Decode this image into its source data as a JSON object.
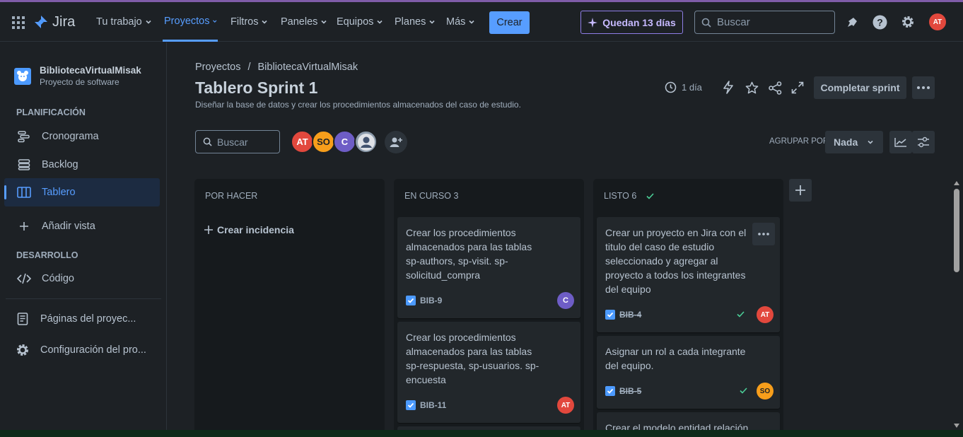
{
  "topnav": {
    "app_name": "Jira",
    "items": [
      "Tu trabajo",
      "Proyectos",
      "Filtros",
      "Paneles",
      "Equipos",
      "Planes",
      "Más"
    ],
    "create_label": "Crear",
    "trial_label": "Quedan 13 días",
    "search_placeholder": "Buscar",
    "user_initials": "AT"
  },
  "sidebar": {
    "project_name": "BibliotecaVirtualMisak",
    "project_type": "Proyecto de software",
    "planning_title": "PLANIFICACIÓN",
    "items": [
      "Cronograma",
      "Backlog",
      "Tablero"
    ],
    "add_view": "Añadir vista",
    "dev_title": "DESARROLLO",
    "code": "Código",
    "pages": "Páginas del proyec...",
    "settings": "Configuración del pro..."
  },
  "header": {
    "breadcrumb_root": "Proyectos",
    "breadcrumb_sep": "/",
    "breadcrumb_project": "BibliotecaVirtualMisak",
    "title": "Tablero Sprint 1",
    "subtitle": "Diseñar la base de datos y crear los procedimientos almacenados del caso de estudio.",
    "time_left": "1 día",
    "complete_sprint": "Completar sprint"
  },
  "toolbar": {
    "search_placeholder": "Buscar",
    "avatars": [
      "AT",
      "SO",
      "C"
    ],
    "group_by_label": "AGRUPAR POR",
    "group_by_value": "Nada"
  },
  "columns": [
    {
      "title": "POR HACER",
      "create_issue": "Crear incidencia"
    },
    {
      "title": "EN CURSO 3",
      "cards": [
        {
          "text": "Crear los procedimientos almacenados para las tablas sp-authors, sp-visit. sp-solicitud_compra",
          "key": "BIB-9",
          "assignee": "C"
        },
        {
          "text": "Crear los procedimientos almacenados para las tablas sp-respuesta, sp-usuarios. sp-encuesta",
          "key": "BIB-11",
          "assignee": "AT"
        }
      ]
    },
    {
      "title": "LISTO 6",
      "cards": [
        {
          "text": "Crear un proyecto en Jira con el titulo del caso de estudio seleccionado y agregar al proyecto a todos los integrantes del equipo",
          "key": "BIB-4",
          "assignee": "AT"
        },
        {
          "text": "Asignar un rol a cada integrante del equipo.",
          "key": "BIB-5",
          "assignee": "SO"
        },
        {
          "text": "Crear el modelo entidad relación",
          "key": "",
          "assignee": ""
        }
      ]
    }
  ],
  "colors": {
    "accent": "#579dff",
    "avatar_at": "#e2483d",
    "avatar_so": "#f79e1b",
    "avatar_c": "#6e5dc6"
  }
}
